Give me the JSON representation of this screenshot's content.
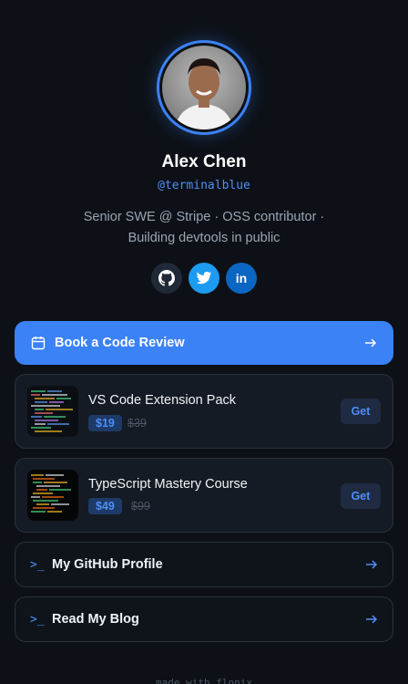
{
  "profile": {
    "name": "Alex Chen",
    "handle": "@terminalblue",
    "bio_line1": "Senior SWE @ Stripe · OSS contributor ·",
    "bio_line2": "Building devtools in public"
  },
  "socials": [
    {
      "icon": "github-icon"
    },
    {
      "icon": "twitter-icon"
    },
    {
      "icon": "linkedin-icon",
      "text": "in"
    }
  ],
  "cta": {
    "label": "Book a Code Review",
    "icon": "calendar-icon"
  },
  "products": [
    {
      "title": "VS Code Extension Pack",
      "price": "$19",
      "old_price": "$39",
      "action": "Get"
    },
    {
      "title": "TypeScript Mastery Course",
      "price": "$49",
      "old_price": "$99",
      "action": "Get"
    }
  ],
  "links": [
    {
      "prompt": ">_",
      "label": "My GitHub Profile"
    },
    {
      "prompt": ">_",
      "label": "Read My Blog"
    }
  ],
  "footer": {
    "text": "made with flonix"
  },
  "colors": {
    "accent": "#3b82f6",
    "background": "#0d1117",
    "card": "#151b24"
  }
}
